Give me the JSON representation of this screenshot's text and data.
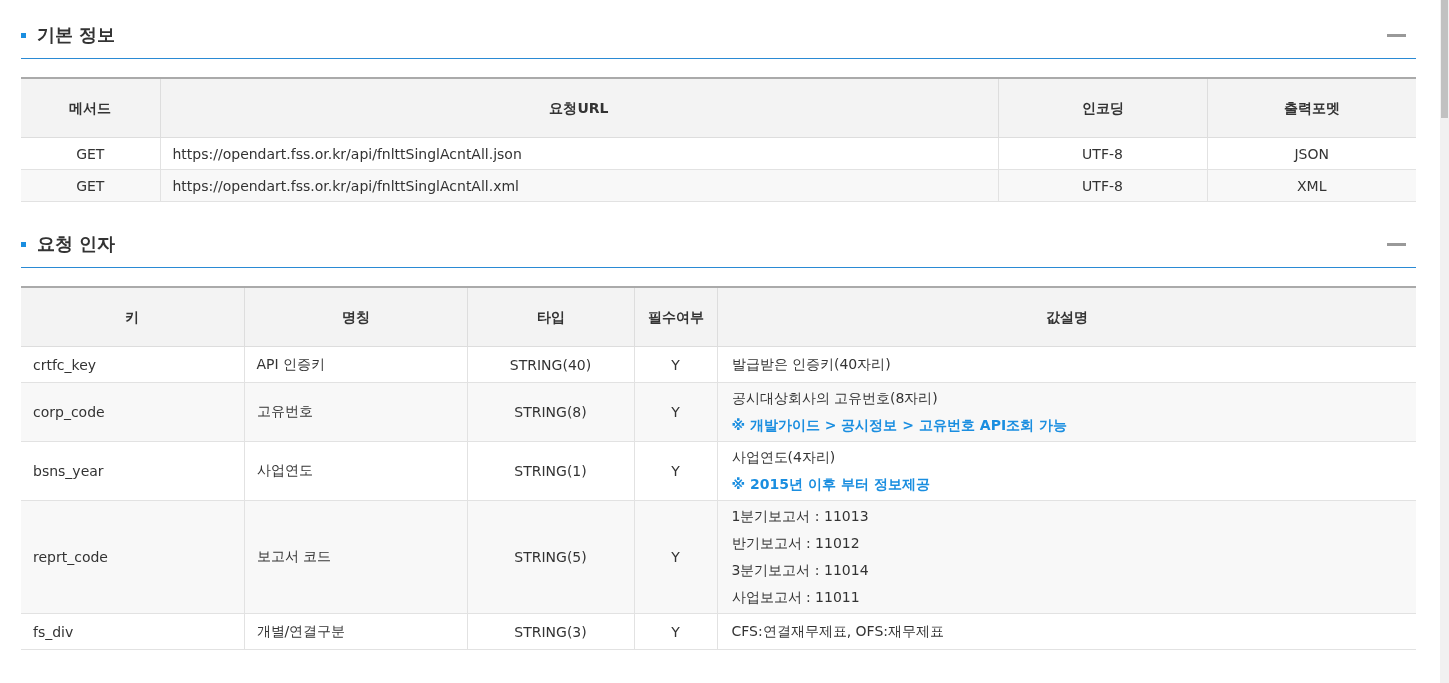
{
  "sections": [
    {
      "kind": "endpoints",
      "title": "기본 정보",
      "columns": [
        "메서드",
        "요청URL",
        "인코딩",
        "출력포멧"
      ],
      "rows": [
        {
          "cells": [
            "GET",
            "https://opendart.fss.or.kr/api/fnlttSinglAcntAll.json",
            "UTF-8",
            "JSON"
          ]
        },
        {
          "cells": [
            "GET",
            "https://opendart.fss.or.kr/api/fnlttSinglAcntAll.xml",
            "UTF-8",
            "XML"
          ]
        }
      ]
    },
    {
      "kind": "params",
      "title": "요청 인자",
      "columns": [
        "키",
        "명칭",
        "타입",
        "필수여부",
        "값설명"
      ],
      "rows": [
        {
          "cells": [
            "crtfc_key",
            "API 인증키",
            "STRING(40)",
            "Y",
            {
              "lines": [
                {
                  "kind": "plain",
                  "text": "발급받은 인증키(40자리)"
                }
              ]
            }
          ]
        },
        {
          "cells": [
            "corp_code",
            "고유번호",
            "STRING(8)",
            "Y",
            {
              "lines": [
                {
                  "kind": "plain",
                  "text": "공시대상회사의 고유번호(8자리)"
                },
                {
                  "kind": "note",
                  "text": "※ 개발가이드 > 공시정보 > 고유번호 API조회 가능"
                }
              ]
            }
          ]
        },
        {
          "cells": [
            "bsns_year",
            "사업연도",
            "STRING(1)",
            "Y",
            {
              "lines": [
                {
                  "kind": "plain",
                  "text": "사업연도(4자리)"
                },
                {
                  "kind": "note",
                  "text": "※ 2015년 이후 부터 정보제공"
                }
              ]
            }
          ]
        },
        {
          "cells": [
            "reprt_code",
            "보고서 코드",
            "STRING(5)",
            "Y",
            {
              "lines": [
                {
                  "kind": "plain",
                  "text": "1분기보고서 : 11013"
                },
                {
                  "kind": "plain",
                  "text": "반기보고서 : 11012"
                },
                {
                  "kind": "plain",
                  "text": "3분기보고서 : 11014"
                },
                {
                  "kind": "plain",
                  "text": "사업보고서 : 11011"
                }
              ]
            }
          ]
        },
        {
          "cells": [
            "fs_div",
            "개별/연결구분",
            "STRING(3)",
            "Y",
            {
              "lines": [
                {
                  "kind": "plain",
                  "text": "CFS:연결재무제표, OFS:재무제표"
                }
              ]
            }
          ]
        }
      ]
    }
  ]
}
